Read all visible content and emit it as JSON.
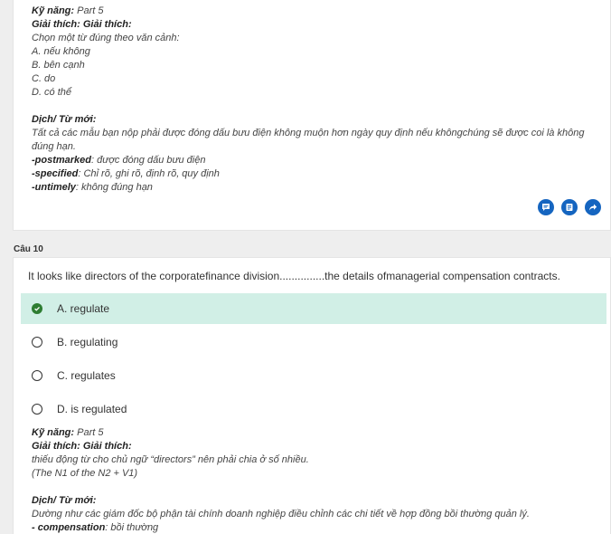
{
  "prev_question": {
    "skill_line": {
      "label": "Kỹ năng:",
      "value": " Part 5"
    },
    "explain_heading": "Giải thích: Giải thích:",
    "explain_text": "Chọn một từ đúng theo văn cảnh:",
    "options": [
      "A. nếu không",
      "B. bên cạnh",
      "C. do",
      "D. có thể"
    ],
    "translation_heading": "Dịch/ Từ mới:",
    "translation_text": "Tất cả các mẫu bạn nộp phải được đóng dấu bưu điện không muộn hơn ngày quy định nếu khôngchúng sẽ được coi là không đúng hạn.",
    "vocab": [
      {
        "term": "-postmarked",
        "meaning": ": được đóng dấu bưu điện"
      },
      {
        "term": "-specified",
        "meaning": ": Chỉ rõ, ghi rõ, định rõ, quy định"
      },
      {
        "term": "-untimely",
        "meaning": ": không đúng hạn"
      }
    ],
    "action_icons": [
      "comment-icon",
      "note-icon",
      "share-icon"
    ]
  },
  "current_question": {
    "number_label": "Câu 10",
    "text": "It looks like directors of the corporatefinance division...............the details ofmanagerial compensation contracts.",
    "options": [
      {
        "label": "A. regulate",
        "selected": true
      },
      {
        "label": "B. regulating",
        "selected": false
      },
      {
        "label": "C. regulates",
        "selected": false
      },
      {
        "label": "D. is regulated",
        "selected": false
      }
    ],
    "skill_line": {
      "label": "Kỹ năng:",
      "value": " Part 5"
    },
    "explain_heading": "Giải thích: Giải thích:",
    "explain_lines": [
      "thiếu động từ cho chủ ngữ “directors” nên phải chia ở số nhiều.",
      "(The N1 of the N2 + V1)"
    ],
    "translation_heading": "Dịch/ Từ mới:",
    "translation_text": "Dường như các giám đốc bộ phận tài chính doanh nghiệp điều chỉnh các chi tiết về hợp đồng bồi thường quản lý.",
    "vocab": [
      {
        "term": "- compensation",
        "meaning": ": bồi thường"
      }
    ]
  },
  "colors": {
    "selected_bg": "#d1efe6",
    "check_green": "#2e7d32",
    "action_blue": "#1565c0"
  }
}
